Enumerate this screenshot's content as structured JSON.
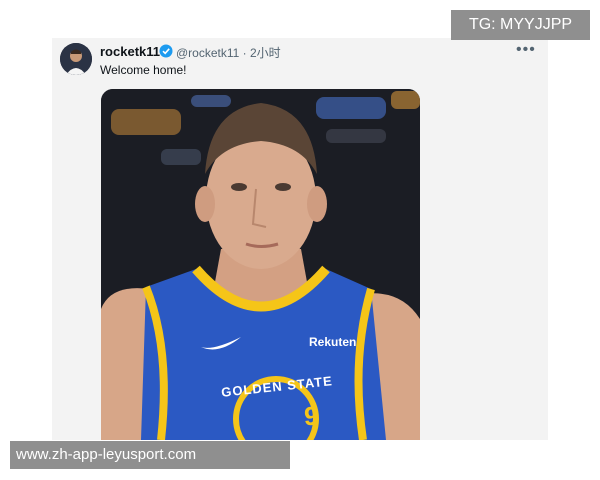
{
  "tweet": {
    "display_name": "rocketk11",
    "handle_time": "@rocketk11 · 2小时",
    "text": "Welcome home!",
    "more_icon": "more-dots-icon",
    "verified_icon": "verified-badge-icon"
  },
  "media": {
    "jersey_sponsor": "Rekuten",
    "jersey_team": "GOLDEN STATE",
    "jersey_number": "9",
    "colors": {
      "jersey": "#2b59c3",
      "trim": "#f5c518",
      "background": "#1b1d24"
    }
  },
  "watermarks": {
    "top_right": "TG: MYYJJPP",
    "bottom_left": "www.zh-app-leyusport.com"
  }
}
